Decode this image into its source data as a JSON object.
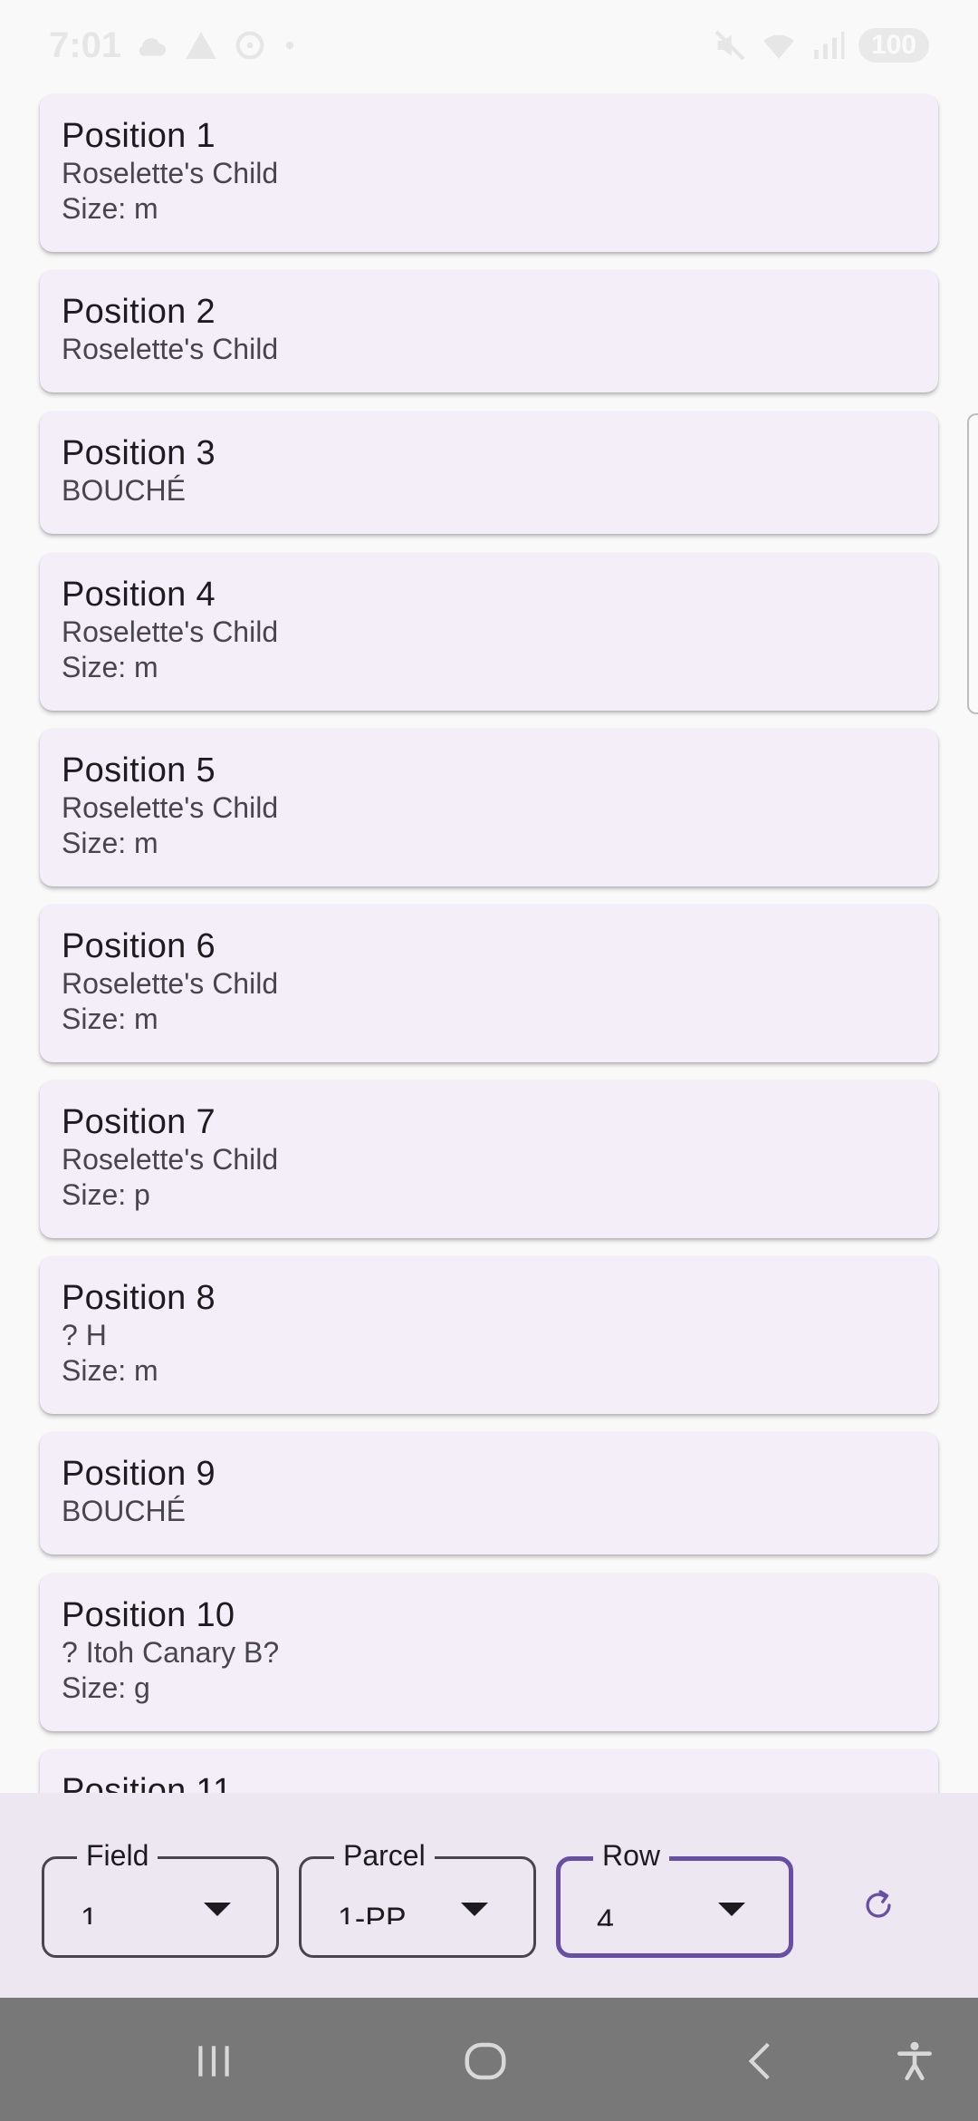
{
  "status_bar": {
    "time": "7:01",
    "battery": "100"
  },
  "positions": [
    {
      "title": "Position 1",
      "lines": [
        "Roselette's Child",
        "Size: m"
      ]
    },
    {
      "title": "Position 2",
      "lines": [
        "Roselette's Child"
      ]
    },
    {
      "title": "Position 3",
      "lines": [
        "BOUCHÉ"
      ]
    },
    {
      "title": "Position 4",
      "lines": [
        "Roselette's Child",
        "Size: m"
      ]
    },
    {
      "title": "Position 5",
      "lines": [
        "Roselette's Child",
        "Size: m"
      ]
    },
    {
      "title": "Position 6",
      "lines": [
        "Roselette's Child",
        "Size: m"
      ]
    },
    {
      "title": "Position 7",
      "lines": [
        "Roselette's Child",
        "Size: p"
      ]
    },
    {
      "title": "Position 8",
      "lines": [
        "? H",
        "Size: m"
      ]
    },
    {
      "title": "Position 9",
      "lines": [
        "BOUCHÉ"
      ]
    },
    {
      "title": "Position 10",
      "lines": [
        "? Itoh Canary B?",
        "Size: g"
      ]
    },
    {
      "title": "Position 11",
      "lines": []
    }
  ],
  "filters": {
    "field": {
      "label": "Field",
      "value": "1"
    },
    "parcel": {
      "label": "Parcel",
      "value": "1-PP"
    },
    "row": {
      "label": "Row",
      "value": "4"
    }
  },
  "colors": {
    "card_background": "#f3eef7",
    "accent": "#6750a4",
    "filter_bar_background": "#ece7f1"
  },
  "icons": {
    "refresh": "refresh-icon",
    "nav_recents": "recents-icon",
    "nav_home": "home-icon",
    "nav_back": "back-icon",
    "nav_accessibility": "accessibility-icon"
  }
}
